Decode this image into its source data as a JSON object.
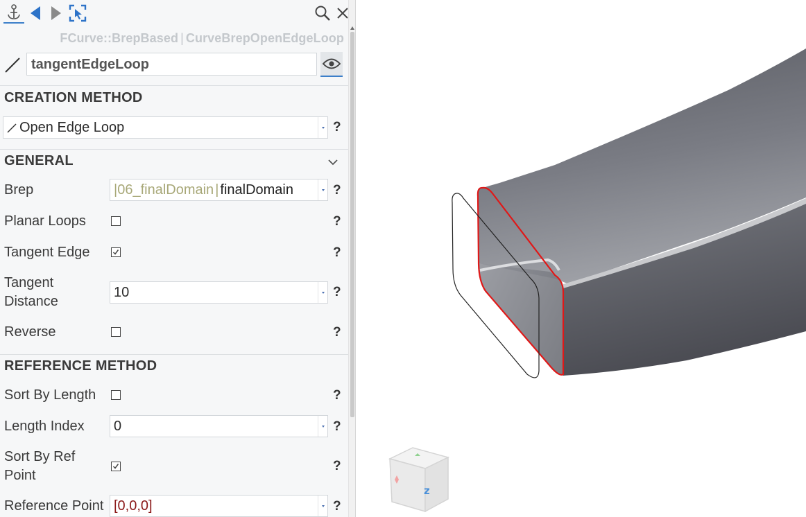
{
  "toolbar": {
    "items": [
      "anchor-icon",
      "back-icon",
      "forward-icon",
      "select-icon",
      "search-icon",
      "close-icon"
    ]
  },
  "object": {
    "type_class": "FCurve::BrepBased",
    "type_name": "CurveBrepOpenEdgeLoop",
    "type_separator": "|",
    "name": "tangentEdgeLoop"
  },
  "creation_method": {
    "title": "CREATION METHOD",
    "selected": "Open Edge Loop",
    "help": "?"
  },
  "general": {
    "title": "GENERAL",
    "brep_label": "Brep",
    "brep_prefix_sep": "|",
    "brep_path": "06_finalDomain",
    "brep_sep": "|",
    "brep_value": "finalDomain",
    "planar_loops_label": "Planar Loops",
    "planar_loops_checked": false,
    "tangent_edge_label": "Tangent Edge",
    "tangent_edge_checked": true,
    "tangent_distance_label_1": "Tangent",
    "tangent_distance_label_2": "Distance",
    "tangent_distance_value": "10",
    "reverse_label": "Reverse",
    "reverse_checked": false,
    "help": "?"
  },
  "reference_method": {
    "title": "REFERENCE METHOD",
    "sort_by_length_label": "Sort By Length",
    "sort_by_length_checked": false,
    "length_index_label": "Length Index",
    "length_index_value": "0",
    "sort_by_ref_point_label_1": "Sort By Ref",
    "sort_by_ref_point_label_2": "Point",
    "sort_by_ref_point_checked": true,
    "reference_point_label": "Reference Point",
    "reference_point_value": "[0,0,0]",
    "help": "?"
  },
  "viewcube": {
    "face_label": "z"
  },
  "colors": {
    "accent": "#3c7fc9",
    "selected_edge": "#e01818",
    "path_text": "#a8a878",
    "ref_point_text": "#8b1a1a"
  }
}
